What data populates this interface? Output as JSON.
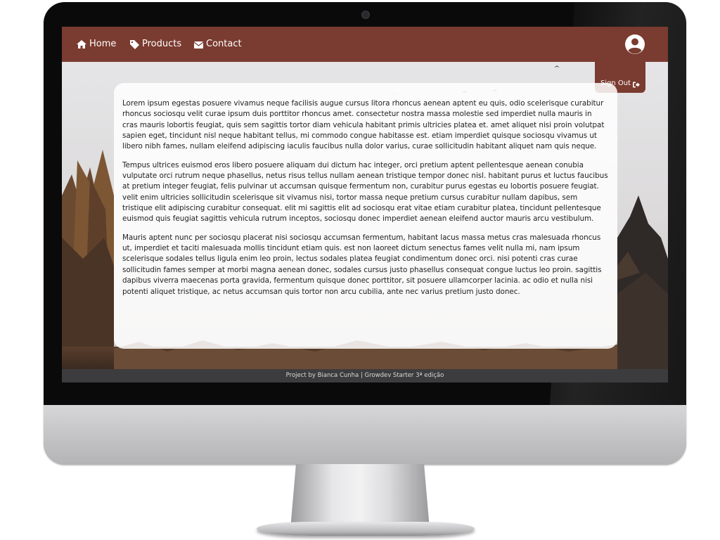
{
  "nav": {
    "items": [
      {
        "label": "Home",
        "icon": "home-icon"
      },
      {
        "label": "Products",
        "icon": "tag-icon"
      },
      {
        "label": "Contact",
        "icon": "envelope-icon"
      }
    ],
    "signout_label": "Sign Out",
    "avatar_icon": "user-circle-icon"
  },
  "content": {
    "paragraphs": [
      "Lorem ipsum egestas posuere vivamus neque facilisis augue cursus litora rhoncus aenean aptent eu quis, odio scelerisque curabitur rhoncus sociosqu velit curae ipsum duis porttitor rhoncus amet. consectetur nostra massa molestie sed imperdiet nulla mauris in cras mauris lobortis feugiat, quis sem sagittis tortor diam vehicula habitant primis ultricies platea et. amet aliquet nisi proin volutpat sapien eget, tincidunt nisl neque habitant tellus, mi commodo congue habitasse est. etiam imperdiet quisque sociosqu vivamus ut libero nibh fames, nullam eleifend adipiscing iaculis faucibus nulla dolor varius, curae sollicitudin habitant aliquet nam quis neque.",
      "Tempus ultrices euismod eros libero posuere aliquam dui dictum hac integer, orci pretium aptent pellentesque aenean conubia vulputate orci rutrum neque phasellus, netus risus tellus nullam aenean tristique tempor donec nisl. habitant purus et luctus faucibus at pretium integer feugiat, felis pulvinar ut accumsan quisque fermentum non, curabitur purus egestas eu lobortis posuere feugiat. velit enim ultricies sollicitudin scelerisque sit vivamus nisi, tortor massa neque pretium cursus curabitur nullam dapibus, sem tristique elit adipiscing curabitur consequat. elit mi sagittis elit ad sociosqu erat vitae etiam curabitur platea, tincidunt pellentesque euismod quis feugiat sagittis vehicula rutrum inceptos, sociosqu donec imperdiet aenean eleifend auctor mauris arcu vestibulum.",
      "Mauris aptent nunc per sociosqu placerat nisi sociosqu accumsan fermentum, habitant lacus massa metus cras malesuada rhoncus ut, imperdiet et taciti malesuada mollis tincidunt etiam quis. est non laoreet dictum senectus fames velit nulla mi, nam ipsum scelerisque sodales tellus ligula enim leo proin, lectus sodales platea feugiat condimentum donec orci. nisi potenti cras curae sollicitudin fames semper at morbi magna aenean donec, sodales cursus justo phasellus consequat congue luctus leo proin. sagittis dapibus viverra maecenas porta gravida, fermentum quisque donec porttitor, sit posuere ullamcorper lacinia. ac odio et nulla nisi potenti aliquet tristique, ac netus accumsan quis tortor non arcu cubilia, ante nec varius pretium justo donec."
    ]
  },
  "footer": {
    "text": "Project by Bianca Cunha | Growdev Starter 3ª edição"
  },
  "colors": {
    "navbar": "#7a3b30",
    "footer": "#3c3c3e",
    "card": "#ffffff"
  }
}
